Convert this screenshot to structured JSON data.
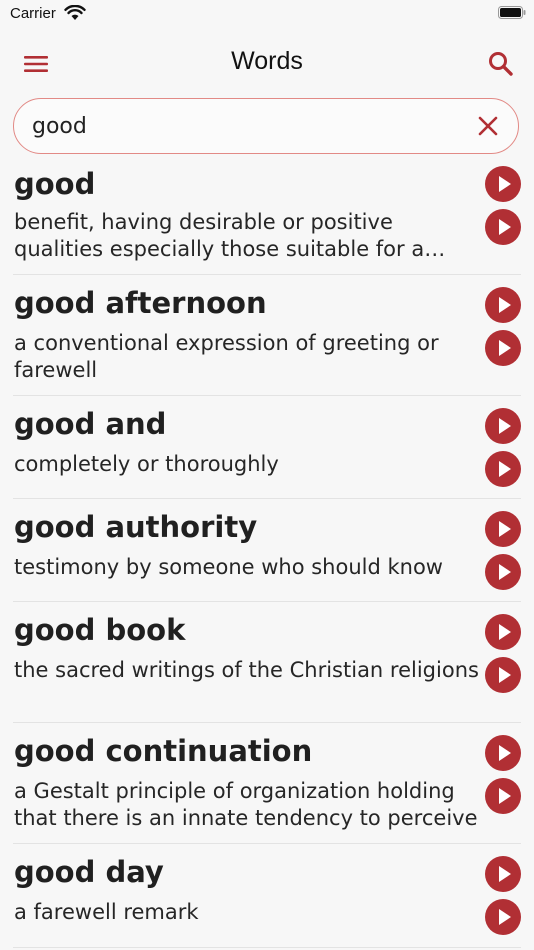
{
  "status": {
    "carrier": "Carrier"
  },
  "nav": {
    "title": "Words"
  },
  "search": {
    "value": "good",
    "placeholder": ""
  },
  "colors": {
    "accent": "#b12f34",
    "search_border": "#e28a86"
  },
  "results": [
    {
      "word": "good",
      "definition": "benefit, having desirable or positive qualities especially those suitable for a thing specified"
    },
    {
      "word": "good afternoon",
      "definition": "a conventional expression of greeting or farewell"
    },
    {
      "word": "good and",
      "definition": "completely or thoroughly"
    },
    {
      "word": "good authority",
      "definition": "testimony by someone who should know"
    },
    {
      "word": "good book",
      "definition": "the sacred writings of the Christian religions"
    },
    {
      "word": "good continuation",
      "definition": "a Gestalt principle of organization holding that there is an innate tendency to perceive"
    },
    {
      "word": "good day",
      "definition": "a farewell remark"
    }
  ]
}
